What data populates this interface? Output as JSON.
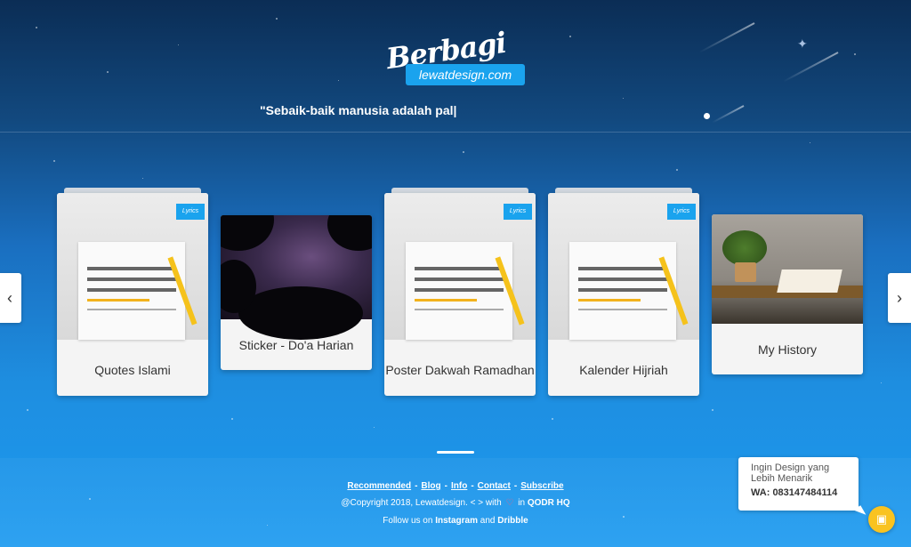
{
  "brand": {
    "script": "Berbagi",
    "badge": "lewatdesign.com"
  },
  "hero": {
    "typing_text": "\"Sebaik-baik manusia adalah pal|"
  },
  "cards": [
    {
      "label": "Quotes Islami",
      "tag": "Lyrics"
    },
    {
      "label": "Sticker - Do'a Harian"
    },
    {
      "label": "Poster Dakwah Ramadhan",
      "tag": "Lyrics"
    },
    {
      "label": "Kalender Hijriah",
      "tag": "Lyrics"
    },
    {
      "label": "My History"
    }
  ],
  "carousel": {
    "prev_icon": "chevron-left-icon",
    "next_icon": "chevron-right-icon",
    "prev": "‹",
    "next": "›"
  },
  "footer": {
    "links": [
      "Recommended",
      "Blog",
      "Info",
      "Contact",
      "Subscribe"
    ],
    "copyright_prefix": "@Copyright 2018, Lewatdesign.",
    "code_icon": "< >",
    "with": "with",
    "heart": "♡",
    "in": "in",
    "hq": "QODR HQ",
    "follow_prefix": "Follow us on",
    "instagram": "Instagram",
    "and": "and",
    "dribble": "Dribble"
  },
  "contact": {
    "title": "Ingin Design yang Lebih Menarik",
    "number": "WA: 083147484114",
    "chat_icon": "chat-icon"
  },
  "colors": {
    "accent": "#1aa3ee",
    "chat": "#f9c320"
  }
}
